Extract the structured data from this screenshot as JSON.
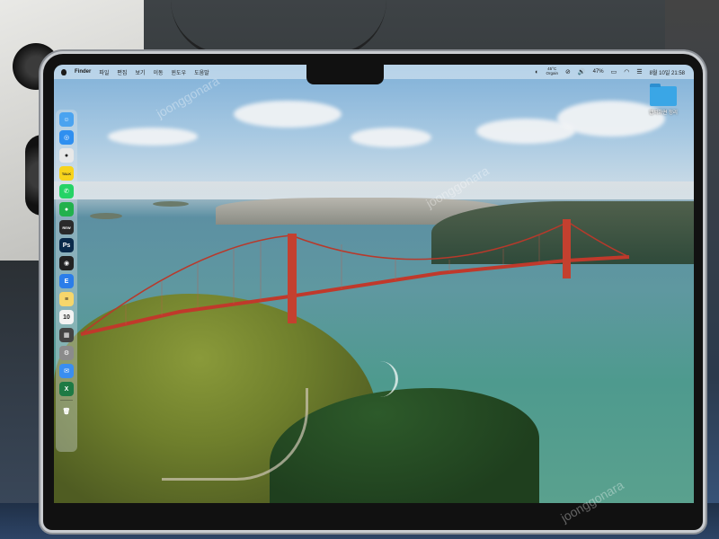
{
  "menubar": {
    "app_name": "Finder",
    "menus": [
      "파일",
      "편집",
      "보기",
      "이동",
      "윈도우",
      "도움말"
    ],
    "weather_temp": "45°C",
    "weather_label": "Orgain",
    "battery": "47%",
    "datetime": "8월 10일 21:58"
  },
  "desktop": {
    "folder_label": "캡쳐화면 정리"
  },
  "dock": {
    "apps": [
      {
        "name": "finder-icon",
        "glyph": "☺",
        "color": "#4aa3f0"
      },
      {
        "name": "safari-icon",
        "glyph": "◎",
        "color": "#2f8ff0"
      },
      {
        "name": "chrome-icon",
        "glyph": "●",
        "color": "#e8e8e8"
      },
      {
        "name": "kakaotalk-icon",
        "glyph": "TALK",
        "color": "#f7d31c"
      },
      {
        "name": "whatsapp-icon",
        "glyph": "✆",
        "color": "#25d366"
      },
      {
        "name": "line-icon",
        "glyph": "●",
        "color": "#22b14c"
      },
      {
        "name": "rew-icon",
        "glyph": "REW",
        "color": "#2a2a2a"
      },
      {
        "name": "photoshop-icon",
        "glyph": "Ps",
        "color": "#0a2a4a"
      },
      {
        "name": "camera-icon",
        "glyph": "◉",
        "color": "#222"
      },
      {
        "name": "app-e-icon",
        "glyph": "E",
        "color": "#2b7de9"
      },
      {
        "name": "notes-icon",
        "glyph": "≡",
        "color": "#f6d66b"
      },
      {
        "name": "calendar-icon",
        "glyph": "10",
        "color": "#f3f3f3"
      },
      {
        "name": "calculator-icon",
        "glyph": "▦",
        "color": "#444"
      },
      {
        "name": "settings-icon",
        "glyph": "⚙",
        "color": "#8b8b8b"
      },
      {
        "name": "mail-icon",
        "glyph": "✉",
        "color": "#3a8ef0"
      },
      {
        "name": "excel-icon",
        "glyph": "X",
        "color": "#1e7a44"
      }
    ],
    "trash": {
      "name": "trash-icon",
      "glyph": "🗑"
    }
  },
  "watermarks": [
    "joonggonara",
    "joonggonara",
    "joonggonara"
  ]
}
